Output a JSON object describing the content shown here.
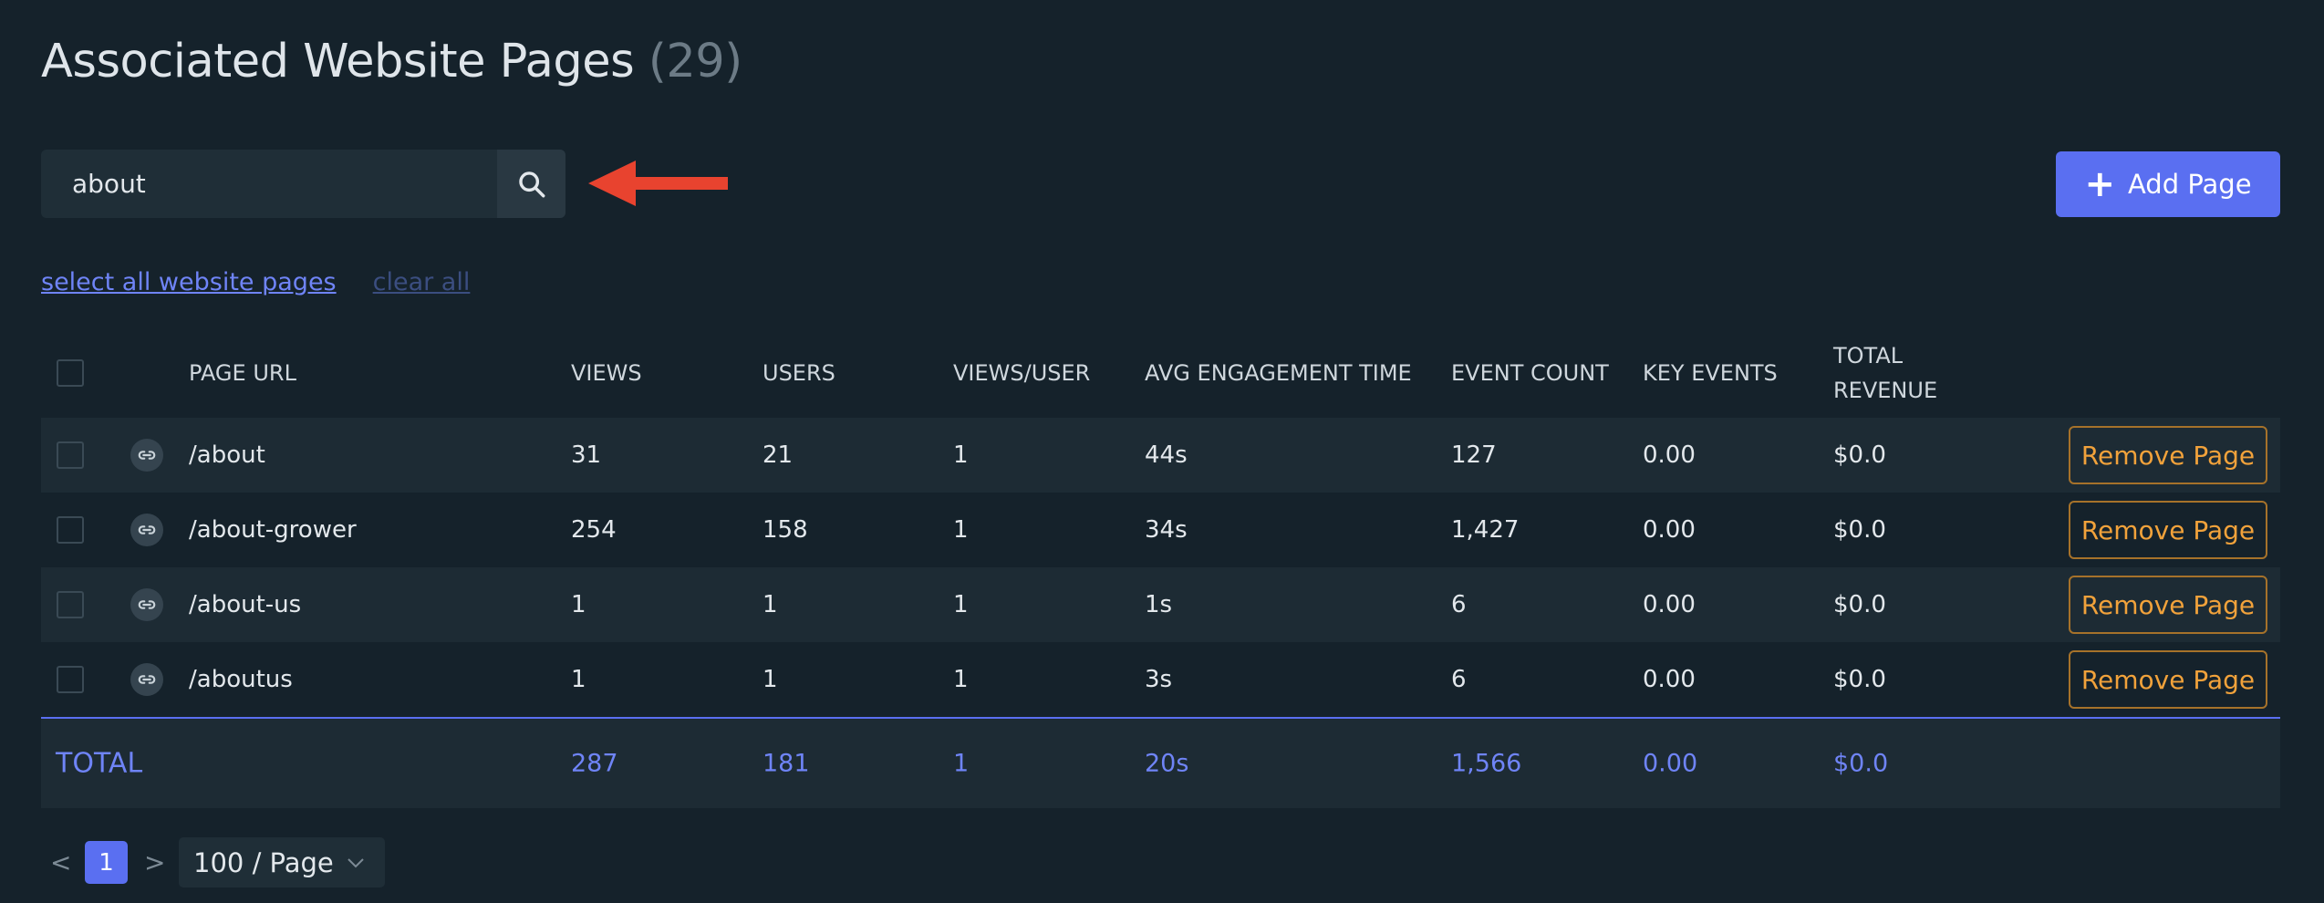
{
  "header": {
    "title": "Associated Website Pages",
    "count": "(29)"
  },
  "search": {
    "value": "about",
    "icon": "search-icon"
  },
  "toolbar": {
    "add_label": "Add Page",
    "select_all": "select all website pages",
    "clear_all": "clear all"
  },
  "colors": {
    "accent": "#5a6ff1",
    "warning": "#f1a23b",
    "arrow": "#e8432f",
    "background": "#15222b"
  },
  "table": {
    "columns": [
      "PAGE URL",
      "VIEWS",
      "USERS",
      "VIEWS/USER",
      "AVG ENGAGEMENT TIME",
      "EVENT COUNT",
      "KEY EVENTS",
      "TOTAL",
      "REVENUE"
    ],
    "rows": [
      {
        "url": "/about",
        "views": "31",
        "users": "21",
        "vpu": "1",
        "aet": "44s",
        "events": "127",
        "key": "0.00",
        "revenue": "$0.0",
        "action": "Remove Page"
      },
      {
        "url": "/about-grower",
        "views": "254",
        "users": "158",
        "vpu": "1",
        "aet": "34s",
        "events": "1,427",
        "key": "0.00",
        "revenue": "$0.0",
        "action": "Remove Page"
      },
      {
        "url": "/about-us",
        "views": "1",
        "users": "1",
        "vpu": "1",
        "aet": "1s",
        "events": "6",
        "key": "0.00",
        "revenue": "$0.0",
        "action": "Remove Page"
      },
      {
        "url": "/aboutus",
        "views": "1",
        "users": "1",
        "vpu": "1",
        "aet": "3s",
        "events": "6",
        "key": "0.00",
        "revenue": "$0.0",
        "action": "Remove Page"
      }
    ],
    "total": {
      "label": "TOTAL",
      "views": "287",
      "users": "181",
      "vpu": "1",
      "aet": "20s",
      "events": "1,566",
      "key": "0.00",
      "revenue": "$0.0"
    }
  },
  "pagination": {
    "prev": "<",
    "current": "1",
    "next": ">",
    "page_size": "100 / Page"
  }
}
